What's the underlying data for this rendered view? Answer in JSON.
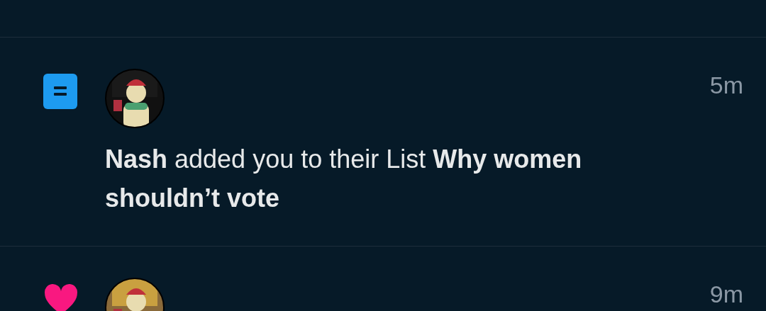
{
  "notifications": [
    {
      "kind": "list",
      "time": "5m",
      "text": "**Nash** added you to their List **Why women shouldn’t vote**"
    },
    {
      "kind": "like",
      "time": "9m"
    }
  ]
}
